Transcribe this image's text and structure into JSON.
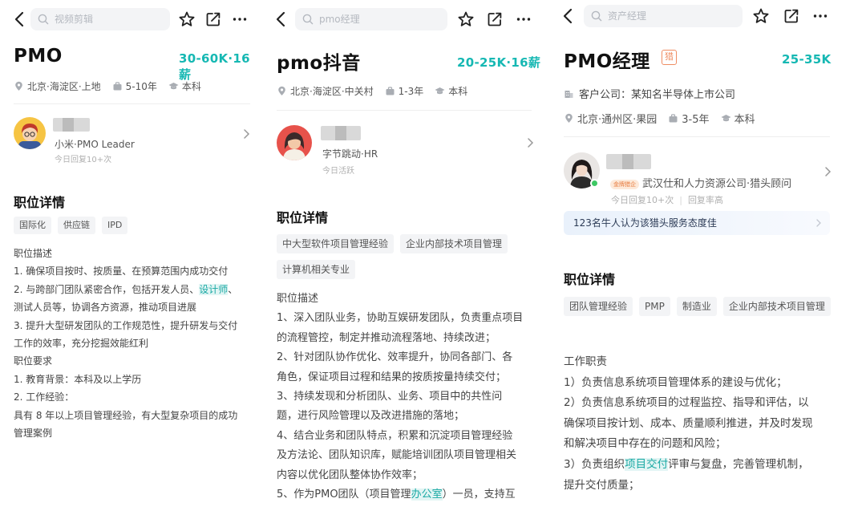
{
  "panels": [
    {
      "search_placeholder": "视频剪辑",
      "title": "PMO",
      "salary": "30-60K·16薪",
      "location": "北京·海淀区·上地",
      "experience": "5-10年",
      "education": "本科",
      "recruiter": {
        "role": "小米·PMO Leader",
        "activity": "今日回复10+次"
      },
      "section_title": "职位详情",
      "tags": [
        "国际化",
        "供应链",
        "IPD"
      ],
      "description": [
        {
          "text": "职位描述"
        },
        {
          "text": "1. 确保项目按时、按质量、在预算范围内成功交付"
        },
        {
          "before": "2. 与跨部门团队紧密合作，包括开发人员、",
          "highlight": "设计师",
          "after": "、"
        },
        {
          "text": "测试人员等，协调各方资源，推动项目进展"
        },
        {
          "text": "3. 提升大型研发团队的工作规范性，提升研发与交付"
        },
        {
          "text": "工作的效率，充分挖掘效能红利"
        },
        {
          "text": "职位要求"
        },
        {
          "text": "1. 教育背景：本科及以上学历"
        },
        {
          "text": "2. 工作经验："
        },
        {
          "text": "具有 8 年以上项目管理经验，有大型复杂项目的成功"
        },
        {
          "text": "管理案例"
        }
      ]
    },
    {
      "search_placeholder": "pmo经理",
      "title": "pmo抖音",
      "salary": "20-25K·16薪",
      "location": "北京·海淀区·中关村",
      "experience": "1-3年",
      "education": "本科",
      "recruiter": {
        "role": "字节跳动·HR",
        "activity": "今日活跃"
      },
      "section_title": "职位详情",
      "tags": [
        "中大型软件项目管理经验",
        "企业内部技术项目管理",
        "计算机相关专业"
      ],
      "description": [
        {
          "text": "职位描述"
        },
        {
          "text": "1、深入团队业务，协助互娱研发团队，负责重点项目"
        },
        {
          "text": "的流程管控，制定并推动流程落地、持续改进；"
        },
        {
          "text": "2、针对团队协作优化、效率提升，协同各部门、各"
        },
        {
          "text": "角色，保证项目过程和结果的按质按量持续交付；"
        },
        {
          "text": "3、持续发现和分析团队、业务、项目中的共性问"
        },
        {
          "text": "题，进行风险管理以及改进措施的落地；"
        },
        {
          "text": "4、结合业务和团队特点，积累和沉淀项目管理经验"
        },
        {
          "text": "及方法论、团队知识库，赋能培训团队项目管理相关"
        },
        {
          "text": "内容以优化团队整体协作效率；"
        },
        {
          "before": "5、作为PMO团队（项目管理",
          "highlight": "办公室",
          "after": "）一员，支持互"
        }
      ]
    },
    {
      "search_placeholder": "资产经理",
      "title": "PMO经理",
      "badge": "猎",
      "salary": "25-35K",
      "client_company": "客户公司：某知名半导体上市公司",
      "location": "北京·通州区·果园",
      "experience": "3-5年",
      "education": "本科",
      "recruiter": {
        "gold_tag": "金牌猎企",
        "role": "武汉仕和人力资源公司·猎头顾问",
        "activity": "今日回复10+次",
        "activity2": "回复率高"
      },
      "banner": "123名牛人认为该猎头服务态度佳",
      "section_title": "职位详情",
      "tags": [
        "团队管理经验",
        "PMP",
        "制造业",
        "企业内部技术项目管理"
      ],
      "description": [
        {
          "text": "工作职责"
        },
        {
          "text": "1）负责信息系统项目管理体系的建设与优化；"
        },
        {
          "text": "2）负责信息系统项目的过程监控、指导和评估，以"
        },
        {
          "text": "确保项目按计划、成本、质量顺利推进，并及时发现"
        },
        {
          "text": "和解决项目中存在的问题和风险；"
        },
        {
          "before": "3）负责组织",
          "highlight": "项目交付",
          "after": "评审与复盘，完善管理机制，"
        },
        {
          "text": "提升交付质量；"
        }
      ]
    }
  ],
  "colors": {
    "accent": "#16b8b3",
    "hunter_badge": "#ef8d63",
    "online": "#3ec864"
  },
  "icons": [
    "back-arrow-icon",
    "search-icon",
    "star-icon",
    "share-icon",
    "more-icon",
    "location-pin-icon",
    "briefcase-icon",
    "graduation-cap-icon",
    "building-icon",
    "chevron-right-icon"
  ]
}
